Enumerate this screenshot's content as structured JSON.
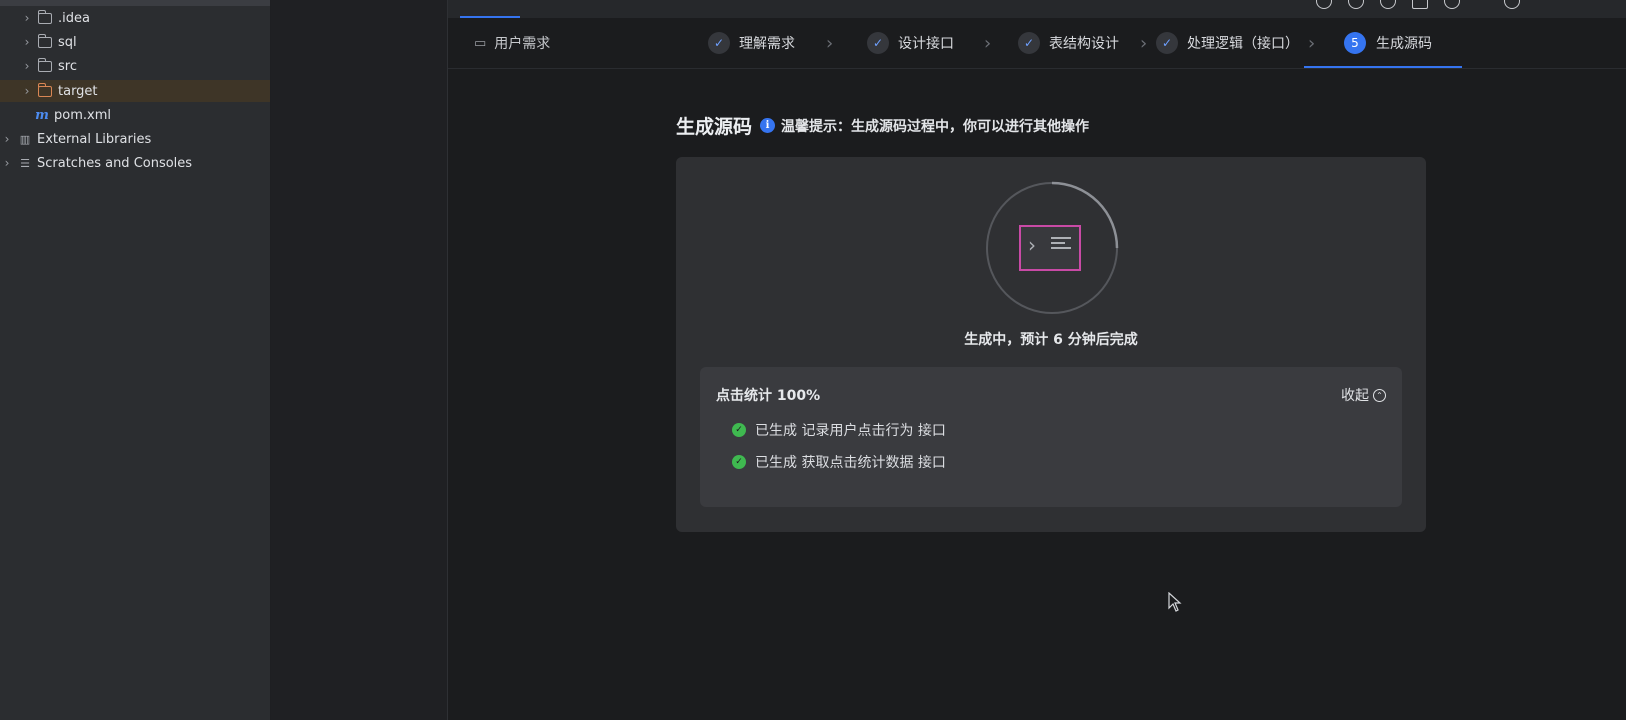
{
  "project_tree": {
    "items": [
      {
        "label": ".idea",
        "icon": "folder-icon"
      },
      {
        "label": "sql",
        "icon": "folder-icon"
      },
      {
        "label": "src",
        "icon": "folder-icon"
      },
      {
        "label": "target",
        "icon": "folder-icon",
        "selected": true,
        "color": "#d98654"
      },
      {
        "label": "pom.xml",
        "icon": "maven-icon"
      },
      {
        "label": "External Libraries",
        "icon": "library-icon"
      },
      {
        "label": "Scratches and Consoles",
        "icon": "scratches-icon"
      }
    ]
  },
  "steps": {
    "requirement_label": "用户需求",
    "items": [
      {
        "label": "理解需求",
        "state": "done"
      },
      {
        "label": "设计接口",
        "state": "done"
      },
      {
        "label": "表结构设计",
        "state": "done"
      },
      {
        "label": "处理逻辑（接口）",
        "state": "done"
      },
      {
        "label": "生成源码",
        "state": "active",
        "number": "5"
      }
    ]
  },
  "main": {
    "title": "生成源码",
    "info_icon": "i",
    "tip": "温馨提示：生成源码过程中，你可以进行其他操作",
    "status": "生成中，预计 6 分钟后完成",
    "progress_panel": {
      "header": "点击统计 100%",
      "collapse_label": "收起",
      "items": [
        {
          "text": "已生成 记录用户点击行为 接口"
        },
        {
          "text": "已生成 获取点击统计数据 接口"
        }
      ]
    }
  },
  "colors": {
    "accent": "#3574f0",
    "success": "#3fb950",
    "terminal_frame": "#c94aa6"
  }
}
